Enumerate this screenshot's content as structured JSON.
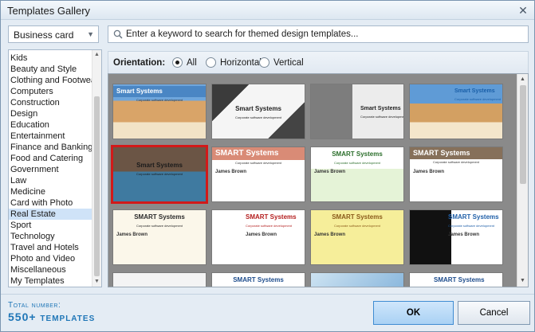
{
  "window": {
    "title": "Templates Gallery",
    "close_glyph": "✕"
  },
  "category_dropdown": {
    "selected": "Business card",
    "arrow": "▼"
  },
  "categories": {
    "items": [
      "Kids",
      "Beauty and Style",
      "Clothing and Footwear",
      "Computers",
      "Construction",
      "Design",
      "Education",
      "Entertainment",
      "Finance and Banking",
      "Food and Catering",
      "Government",
      "Law",
      "Medicine",
      "Card with Photo",
      "Real Estate",
      "Sport",
      "Technology",
      "Travel and Hotels",
      "Photo and Video",
      "Miscellaneous",
      "My Templates"
    ],
    "selected": "Real Estate"
  },
  "search": {
    "placeholder": "Enter a keyword to search for themed design templates..."
  },
  "orientation": {
    "label": "Orientation:",
    "options": [
      "All",
      "Horizontal",
      "Vertical"
    ],
    "selected": "All"
  },
  "templates": [
    {
      "style": "building-blue",
      "company": "Smart Systems",
      "tagline": "Corporate software development",
      "person": "",
      "selected": false
    },
    {
      "style": "white-arch",
      "company": "Smart Systems",
      "tagline": "Corporate software development",
      "person": "",
      "selected": false
    },
    {
      "style": "grey-tower",
      "company": "Smart Systems",
      "tagline": "Corporate software development",
      "person": "",
      "selected": false
    },
    {
      "style": "building-blue-2",
      "company": "Smart Systems",
      "tagline": "Corporate software development",
      "person": "",
      "selected": false
    },
    {
      "style": "pool-house",
      "company": "Smart Systems",
      "tagline": "Corporate software development",
      "person": "",
      "selected": true
    },
    {
      "style": "salmon-house",
      "company": "SMART Systems",
      "tagline": "Corporate software development",
      "person": "James Brown",
      "selected": false
    },
    {
      "style": "green-house",
      "company": "SMART Systems",
      "tagline": "Corporate software development",
      "person": "James Brown",
      "selected": false
    },
    {
      "style": "brown-house",
      "company": "SMART Systems",
      "tagline": "Corporate software development",
      "person": "James Brown",
      "selected": false
    },
    {
      "style": "cream-house",
      "company": "SMART Systems",
      "tagline": "Corporate software development",
      "person": "James Brown",
      "selected": false
    },
    {
      "style": "red-roof",
      "company": "SMART Systems",
      "tagline": "Corporate software development",
      "person": "James Brown",
      "selected": false
    },
    {
      "style": "yellow-keys",
      "company": "SMART Systems",
      "tagline": "Corporate software development",
      "person": "James Brown",
      "selected": false
    },
    {
      "style": "black-blue",
      "company": "SMART Systems",
      "tagline": "Corporate software development",
      "person": "James Brown",
      "selected": false
    },
    {
      "style": "partial-1",
      "company": "",
      "tagline": "",
      "person": "",
      "selected": false
    },
    {
      "style": "partial-2",
      "company": "SMART Systems",
      "tagline": "",
      "person": "",
      "selected": false
    },
    {
      "style": "partial-3",
      "company": "",
      "tagline": "",
      "person": "",
      "selected": false
    },
    {
      "style": "partial-4",
      "company": "SMART Systems",
      "tagline": "",
      "person": "",
      "selected": false
    }
  ],
  "footer": {
    "total_label": "Total number:",
    "total_value": "550+ templates",
    "ok_label": "OK",
    "cancel_label": "Cancel"
  },
  "colors": {
    "accent_blue": "#1f76b7",
    "selection_red": "#d21919",
    "list_selection": "#cfe3f8"
  }
}
